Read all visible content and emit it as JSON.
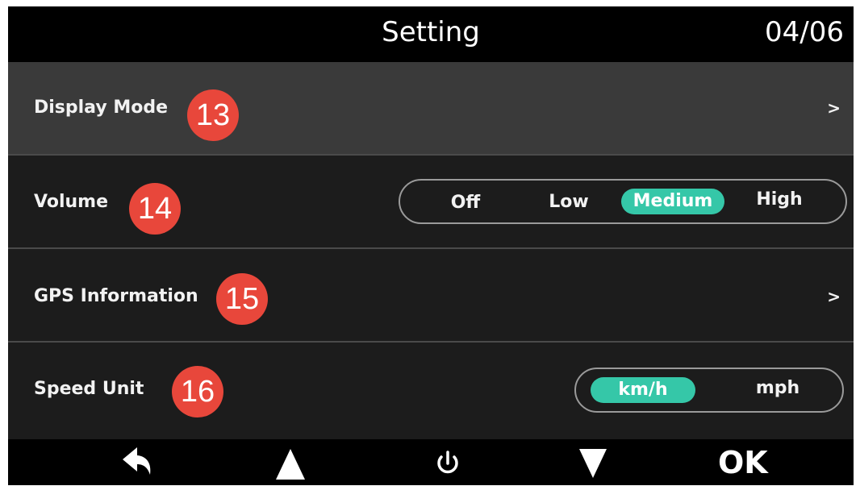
{
  "header": {
    "title": "Setting",
    "page_indicator": "04/06"
  },
  "rows": [
    {
      "label": "Display Mode",
      "badge": "13",
      "chevron": ">"
    },
    {
      "label": "Volume",
      "badge": "14",
      "options": [
        "Off",
        "Low",
        "Medium",
        "High"
      ],
      "selected": "Medium"
    },
    {
      "label": "GPS Information",
      "badge": "15",
      "chevron": ">"
    },
    {
      "label": "Speed Unit",
      "badge": "16",
      "options": [
        "km/h",
        "mph"
      ],
      "selected": "km/h"
    }
  ],
  "footer": {
    "buttons": [
      {
        "icon": "back-arrow-icon"
      },
      {
        "icon": "up-triangle-icon"
      },
      {
        "icon": "power-icon"
      },
      {
        "icon": "down-triangle-icon"
      },
      {
        "label": "OK"
      }
    ]
  },
  "colors": {
    "accent": "#35c7a8",
    "badge": "#e8473b",
    "selected_row": "#3a3a3a",
    "background": "#1c1c1c",
    "bar": "#000000"
  }
}
